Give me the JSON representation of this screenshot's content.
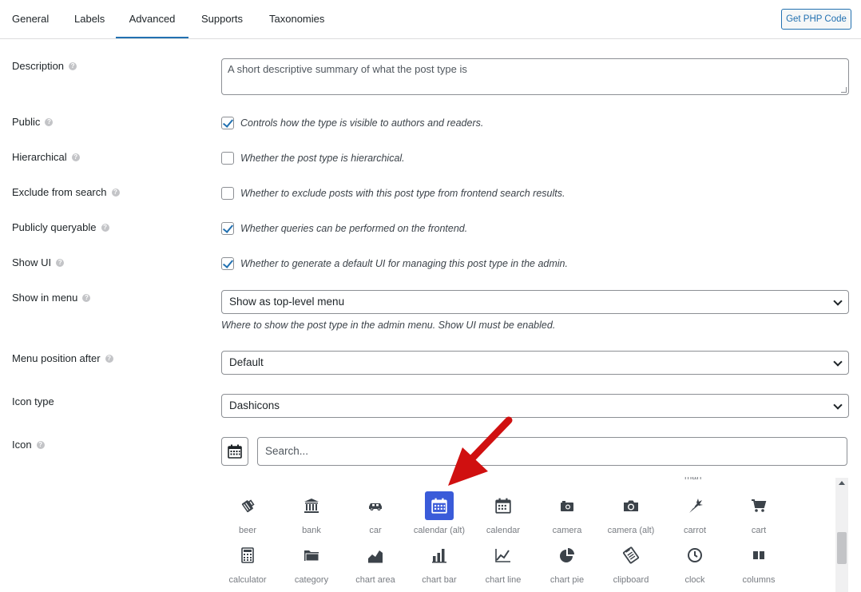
{
  "tabs": [
    {
      "label": "General"
    },
    {
      "label": "Labels"
    },
    {
      "label": "Advanced"
    },
    {
      "label": "Supports"
    },
    {
      "label": "Taxonomies"
    }
  ],
  "get_php_label": "Get PHP Code",
  "description": {
    "label": "Description",
    "value": "A short descriptive summary of what the post type is"
  },
  "public": {
    "label": "Public",
    "desc": "Controls how the type is visible to authors and readers.",
    "checked": true
  },
  "hierarchical": {
    "label": "Hierarchical",
    "desc": "Whether the post type is hierarchical.",
    "checked": false
  },
  "exclude_search": {
    "label": "Exclude from search",
    "desc": "Whether to exclude posts with this post type from frontend search results.",
    "checked": false
  },
  "publicly_queryable": {
    "label": "Publicly queryable",
    "desc": "Whether queries can be performed on the frontend.",
    "checked": true
  },
  "show_ui": {
    "label": "Show UI",
    "desc": "Whether to generate a default UI for managing this post type in the admin.",
    "checked": true
  },
  "show_in_menu": {
    "label": "Show in menu",
    "value": "Show as top-level menu",
    "desc": "Where to show the post type in the admin menu. Show UI must be enabled."
  },
  "menu_position": {
    "label": "Menu position after",
    "value": "Default"
  },
  "icon_type": {
    "label": "Icon type",
    "value": "Dashicons"
  },
  "icon": {
    "label": "Icon",
    "search_placeholder": "Search...",
    "selected": "calendar (alt)"
  },
  "icon_grid": {
    "cutoff_label": "man",
    "row1": [
      "beer",
      "bank",
      "car",
      "calendar (alt)",
      "calendar",
      "camera",
      "camera (alt)",
      "carrot",
      "cart"
    ],
    "row2": [
      "calculator",
      "category",
      "chart area",
      "chart bar",
      "chart line",
      "chart pie",
      "clipboard",
      "clock",
      "columns"
    ]
  },
  "colors": {
    "accent": "#2271b1",
    "selected_icon_bg": "#3a5bd9",
    "arrow": "#d01010"
  }
}
